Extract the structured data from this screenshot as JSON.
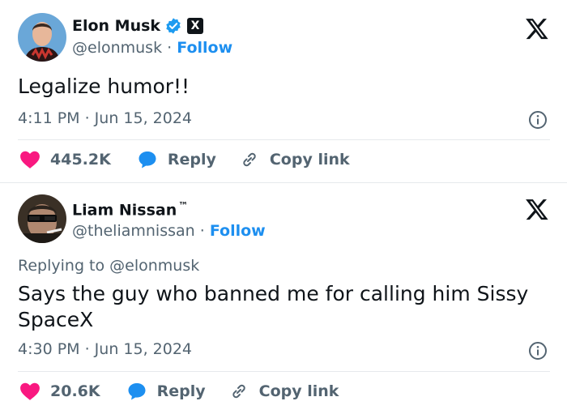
{
  "tweets": [
    {
      "author": {
        "name": "Elon Musk",
        "handle": "@elonmusk",
        "follow_label": "Follow",
        "verified_icon": "verified-badge-icon",
        "affiliate_badge": "X"
      },
      "text": "Legalize humor!!",
      "timestamp": "4:11 PM · Jun 15, 2024",
      "likes": "445.2K",
      "reply_label": "Reply",
      "copy_link_label": "Copy link"
    },
    {
      "author": {
        "name": "Liam Nissan",
        "trademark": "™",
        "handle": "@theliamnissan",
        "follow_label": "Follow"
      },
      "replying_to": "Replying to @elonmusk",
      "text": "Says the guy who banned me for calling him Sissy SpaceX",
      "timestamp": "4:30 PM · Jun 15, 2024",
      "likes": "20.6K",
      "reply_label": "Reply",
      "copy_link_label": "Copy link"
    }
  ],
  "separator": "·",
  "colors": {
    "like": "#f91880",
    "reply": "#1d8ff0",
    "follow": "#1d8ff0",
    "muted": "#536471",
    "text": "#0f1419",
    "verified": "#1d9bf0"
  }
}
